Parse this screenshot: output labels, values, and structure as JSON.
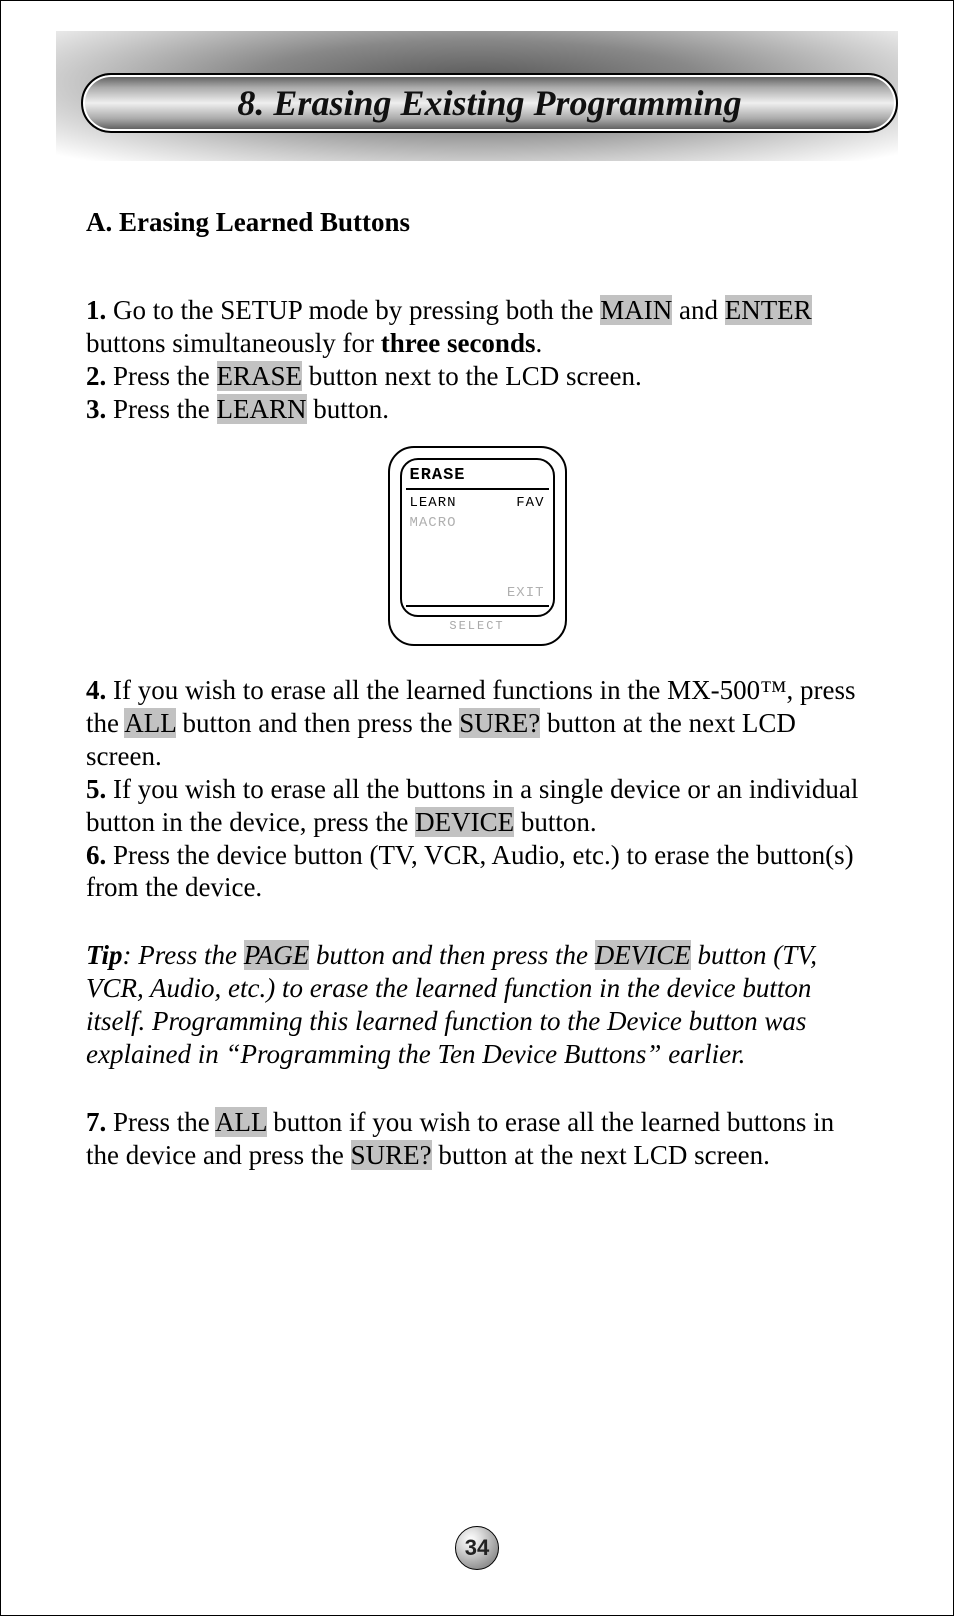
{
  "chapter": {
    "title": "8. Erasing Existing Programming"
  },
  "section": {
    "heading": "A. Erasing Learned Buttons"
  },
  "steps": {
    "s1": {
      "num": "1.",
      "pre": " Go to the SETUP mode by pressing both the ",
      "btn1": "MAIN",
      "mid": " and ",
      "btn2": "ENTER",
      "post1": " buttons simultaneously for ",
      "bold": "three seconds",
      "post2": "."
    },
    "s2": {
      "num": "2.",
      "pre": " Press the ",
      "btn": "ERASE",
      "post": " button next to the LCD screen."
    },
    "s3": {
      "num": "3.",
      "pre": " Press the ",
      "btn": "LEARN",
      "post": " button."
    },
    "s4": {
      "num": "4.",
      "pre": " If you wish to erase all the learned functions in the MX-500™, press the ",
      "btn1": "ALL",
      "mid": " button and then press the ",
      "btn2": "SURE?",
      "post": " button at the next LCD screen."
    },
    "s5": {
      "num": "5.",
      "pre": " If you wish to erase all the buttons in a single device or an individual button in the device, press the ",
      "btn": "DEVICE",
      "post": " button."
    },
    "s6": {
      "num": "6.",
      "text": " Press the device button (TV, VCR, Audio, etc.) to erase the button(s) from the device."
    },
    "s7": {
      "num": "7.",
      "pre": " Press the ",
      "btn1": "ALL",
      "mid": " button if you wish to erase all the learned buttons in the device and press the ",
      "btn2": "SURE?",
      "post": " button at the next LCD screen."
    }
  },
  "tip": {
    "label": "Tip",
    "pre": ": Press the ",
    "btn1": "PAGE",
    "mid": " button and then press the ",
    "btn2": "DEVICE",
    "post": " button (TV, VCR, Audio, etc.) to erase the learned function in the device button itself. Programming this learned function to the Device button was explained in “Programming the Ten Device Buttons” earlier."
  },
  "lcd": {
    "title": "ERASE",
    "row1_left": "LEARN",
    "row1_right": "FAV",
    "row2_left": "MACRO",
    "row_exit": "EXIT",
    "bottom": "SELECT"
  },
  "page_number": "34"
}
